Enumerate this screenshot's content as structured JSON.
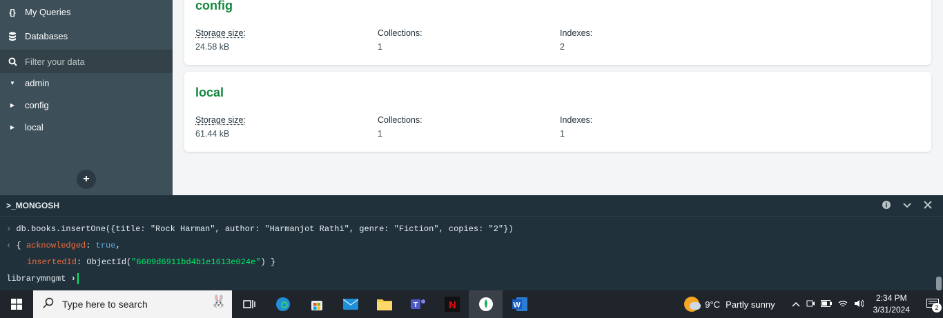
{
  "sidebar": {
    "nav": [
      {
        "icon": "{}",
        "label": "My Queries"
      },
      {
        "icon": "database-icon",
        "label": "Databases"
      }
    ],
    "filter_placeholder": "Filter your data",
    "databases": [
      {
        "name": "admin",
        "expanded": true
      },
      {
        "name": "config",
        "expanded": false
      },
      {
        "name": "local",
        "expanded": false
      }
    ],
    "add_label": "+"
  },
  "main": {
    "cards": [
      {
        "name": "config",
        "storage_label": "Storage size:",
        "storage_value": "24.58 kB",
        "collections_label": "Collections:",
        "collections_value": "1",
        "indexes_label": "Indexes:",
        "indexes_value": "2"
      },
      {
        "name": "local",
        "storage_label": "Storage size:",
        "storage_value": "61.44 kB",
        "collections_label": "Collections:",
        "collections_value": "1",
        "indexes_label": "Indexes:",
        "indexes_value": "1"
      }
    ]
  },
  "shell": {
    "title": ">_MONGOSH",
    "command": "db.books.insertOne({title: \"Rock Harman\", author: \"Harmanjot Rathi\", genre: \"Fiction\", copies: \"2\"})",
    "result_open": "{ ",
    "ack_key": "acknowledged",
    "ack_value": "true",
    "inserted_key": "insertedId",
    "objectid_prefix": "ObjectId(",
    "objectid_value": "\"6609d6911bd4b1e1613e024e\"",
    "objectid_suffix": ") }",
    "prompt": "librarymngmt"
  },
  "taskbar": {
    "search_placeholder": "Type here to search",
    "weather_temp": "9°C",
    "weather_text": "Partly sunny",
    "time": "2:34 PM",
    "date": "3/31/2024",
    "notification_count": "2"
  },
  "colors": {
    "sidebar_bg": "#3d4f58",
    "db_title": "#13873e",
    "shell_bg": "#21313c",
    "accent_green": "#00ed64"
  }
}
